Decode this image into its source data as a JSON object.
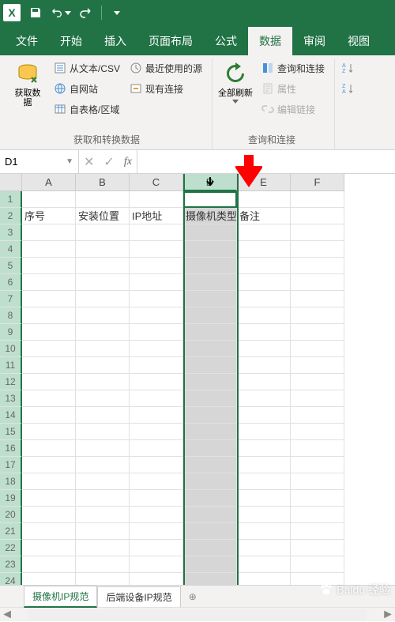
{
  "app": {
    "name": "Excel"
  },
  "qat": {
    "save": "保存",
    "undo": "撤销",
    "redo": "恢复"
  },
  "tabs": {
    "file": "文件",
    "home": "开始",
    "insert": "插入",
    "pagelayout": "页面布局",
    "formulas": "公式",
    "data": "数据",
    "review": "审阅",
    "view": "视图",
    "active": "data"
  },
  "ribbon": {
    "group_get": {
      "label": "获取和转换数据",
      "getdata": "获取数\n据",
      "fromcsv": "从文本/CSV",
      "fromweb": "自网站",
      "fromtable": "自表格/区域",
      "recent": "最近使用的源",
      "existing": "现有连接"
    },
    "group_conn": {
      "label": "查询和连接",
      "refreshall": "全部刷新",
      "queries": "查询和连接",
      "properties": "属性",
      "editlinks": "编辑链接"
    },
    "group_sort": {
      "sortaz": "A→Z",
      "sortza": "Z→A"
    }
  },
  "namebox": {
    "value": "D1"
  },
  "columns": [
    "A",
    "B",
    "C",
    "D",
    "E",
    "F"
  ],
  "row_count": 24,
  "selected_col_index": 3,
  "cells": {
    "row2": [
      "序号",
      "安装位置",
      "IP地址",
      "摄像机类型",
      "备注"
    ]
  },
  "sheets": {
    "active": 0,
    "items": [
      "摄像机IP规范",
      "后端设备IP规范"
    ]
  },
  "watermark": "Baidu 经验"
}
